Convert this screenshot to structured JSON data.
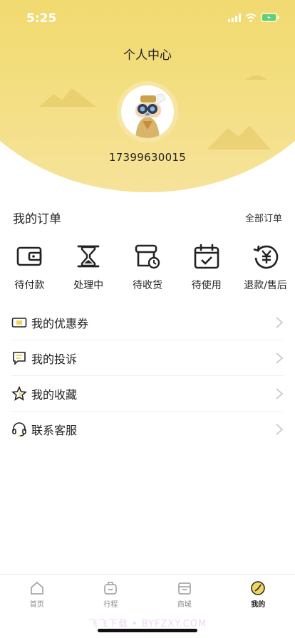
{
  "status_bar": {
    "time": "5:25"
  },
  "header": {
    "title": "个人中心",
    "phone": "17399630015"
  },
  "orders": {
    "title": "我的订单",
    "all_label": "全部订单",
    "items": [
      {
        "label": "待付款",
        "icon": "wallet-icon"
      },
      {
        "label": "处理中",
        "icon": "hourglass-icon"
      },
      {
        "label": "待收货",
        "icon": "package-clock-icon"
      },
      {
        "label": "待使用",
        "icon": "calendar-check-icon"
      },
      {
        "label": "退款/售后",
        "icon": "refund-yen-icon"
      }
    ]
  },
  "menu": [
    {
      "label": "我的优惠券",
      "icon": "coupon-icon"
    },
    {
      "label": "我的投诉",
      "icon": "complaint-icon"
    },
    {
      "label": "我的收藏",
      "icon": "star-icon"
    },
    {
      "label": "联系客服",
      "icon": "headset-icon"
    }
  ],
  "tabbar": [
    {
      "label": "首页",
      "icon": "home-icon",
      "active": false
    },
    {
      "label": "行程",
      "icon": "trip-icon",
      "active": false
    },
    {
      "label": "商城",
      "icon": "shop-icon",
      "active": false
    },
    {
      "label": "我的",
      "icon": "profile-icon",
      "active": true
    }
  ],
  "watermark": "飞飞下载 • BYFZXY.COM",
  "colors": {
    "accent": "#f0d564",
    "text": "#222222",
    "muted": "#8a8a8a"
  }
}
